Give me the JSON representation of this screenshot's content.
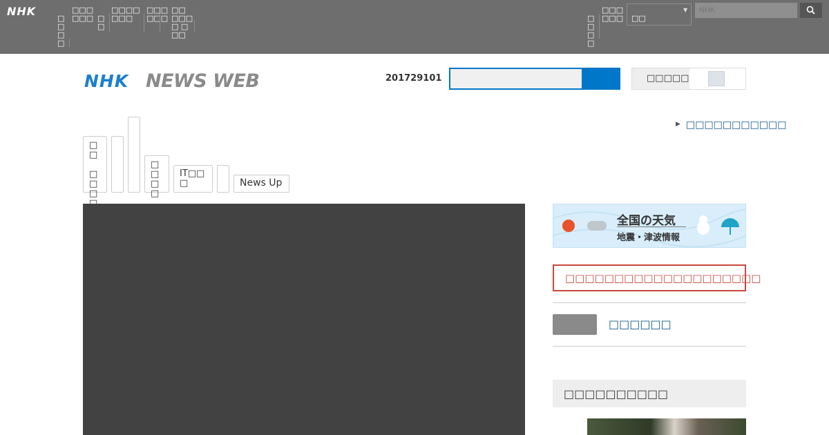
{
  "global_nav": {
    "logo": "NHK",
    "items": [
      "□□\n□□",
      "□□□\n□□□",
      "□□",
      "□□□□\n□□□",
      "□□□\n□□□",
      "□□\n□□□□\n□□□"
    ],
    "right_items": [
      "□□\n□□",
      "□□□\n□□□"
    ],
    "select_value": "□□",
    "search_placeholder": "NHK"
  },
  "header": {
    "logo_nhk": "NHK",
    "logo_newsweb": "NEWS WEB",
    "date": "201729101",
    "toggle_label": "□□□□□"
  },
  "top_link": "□□□□□□□□□□□",
  "tabs": [
    "□□\n\n□□\n□□",
    "",
    "",
    "□□\n□□",
    "IT□□□",
    "",
    "News Up"
  ],
  "sidebar": {
    "weather_title": "全国の天気",
    "weather_sub": "地震・津波情報",
    "alert_text": "□□□□□□□□□□□□□□□□□□□□",
    "thumb_link": "□□□□□□",
    "section_heading": "□□□□□□□□□□"
  },
  "colors": {
    "nav_bg": "#6e6e6e",
    "brand_blue": "#0077c8",
    "link": "#0f5a87",
    "alert": "#c8463b"
  }
}
